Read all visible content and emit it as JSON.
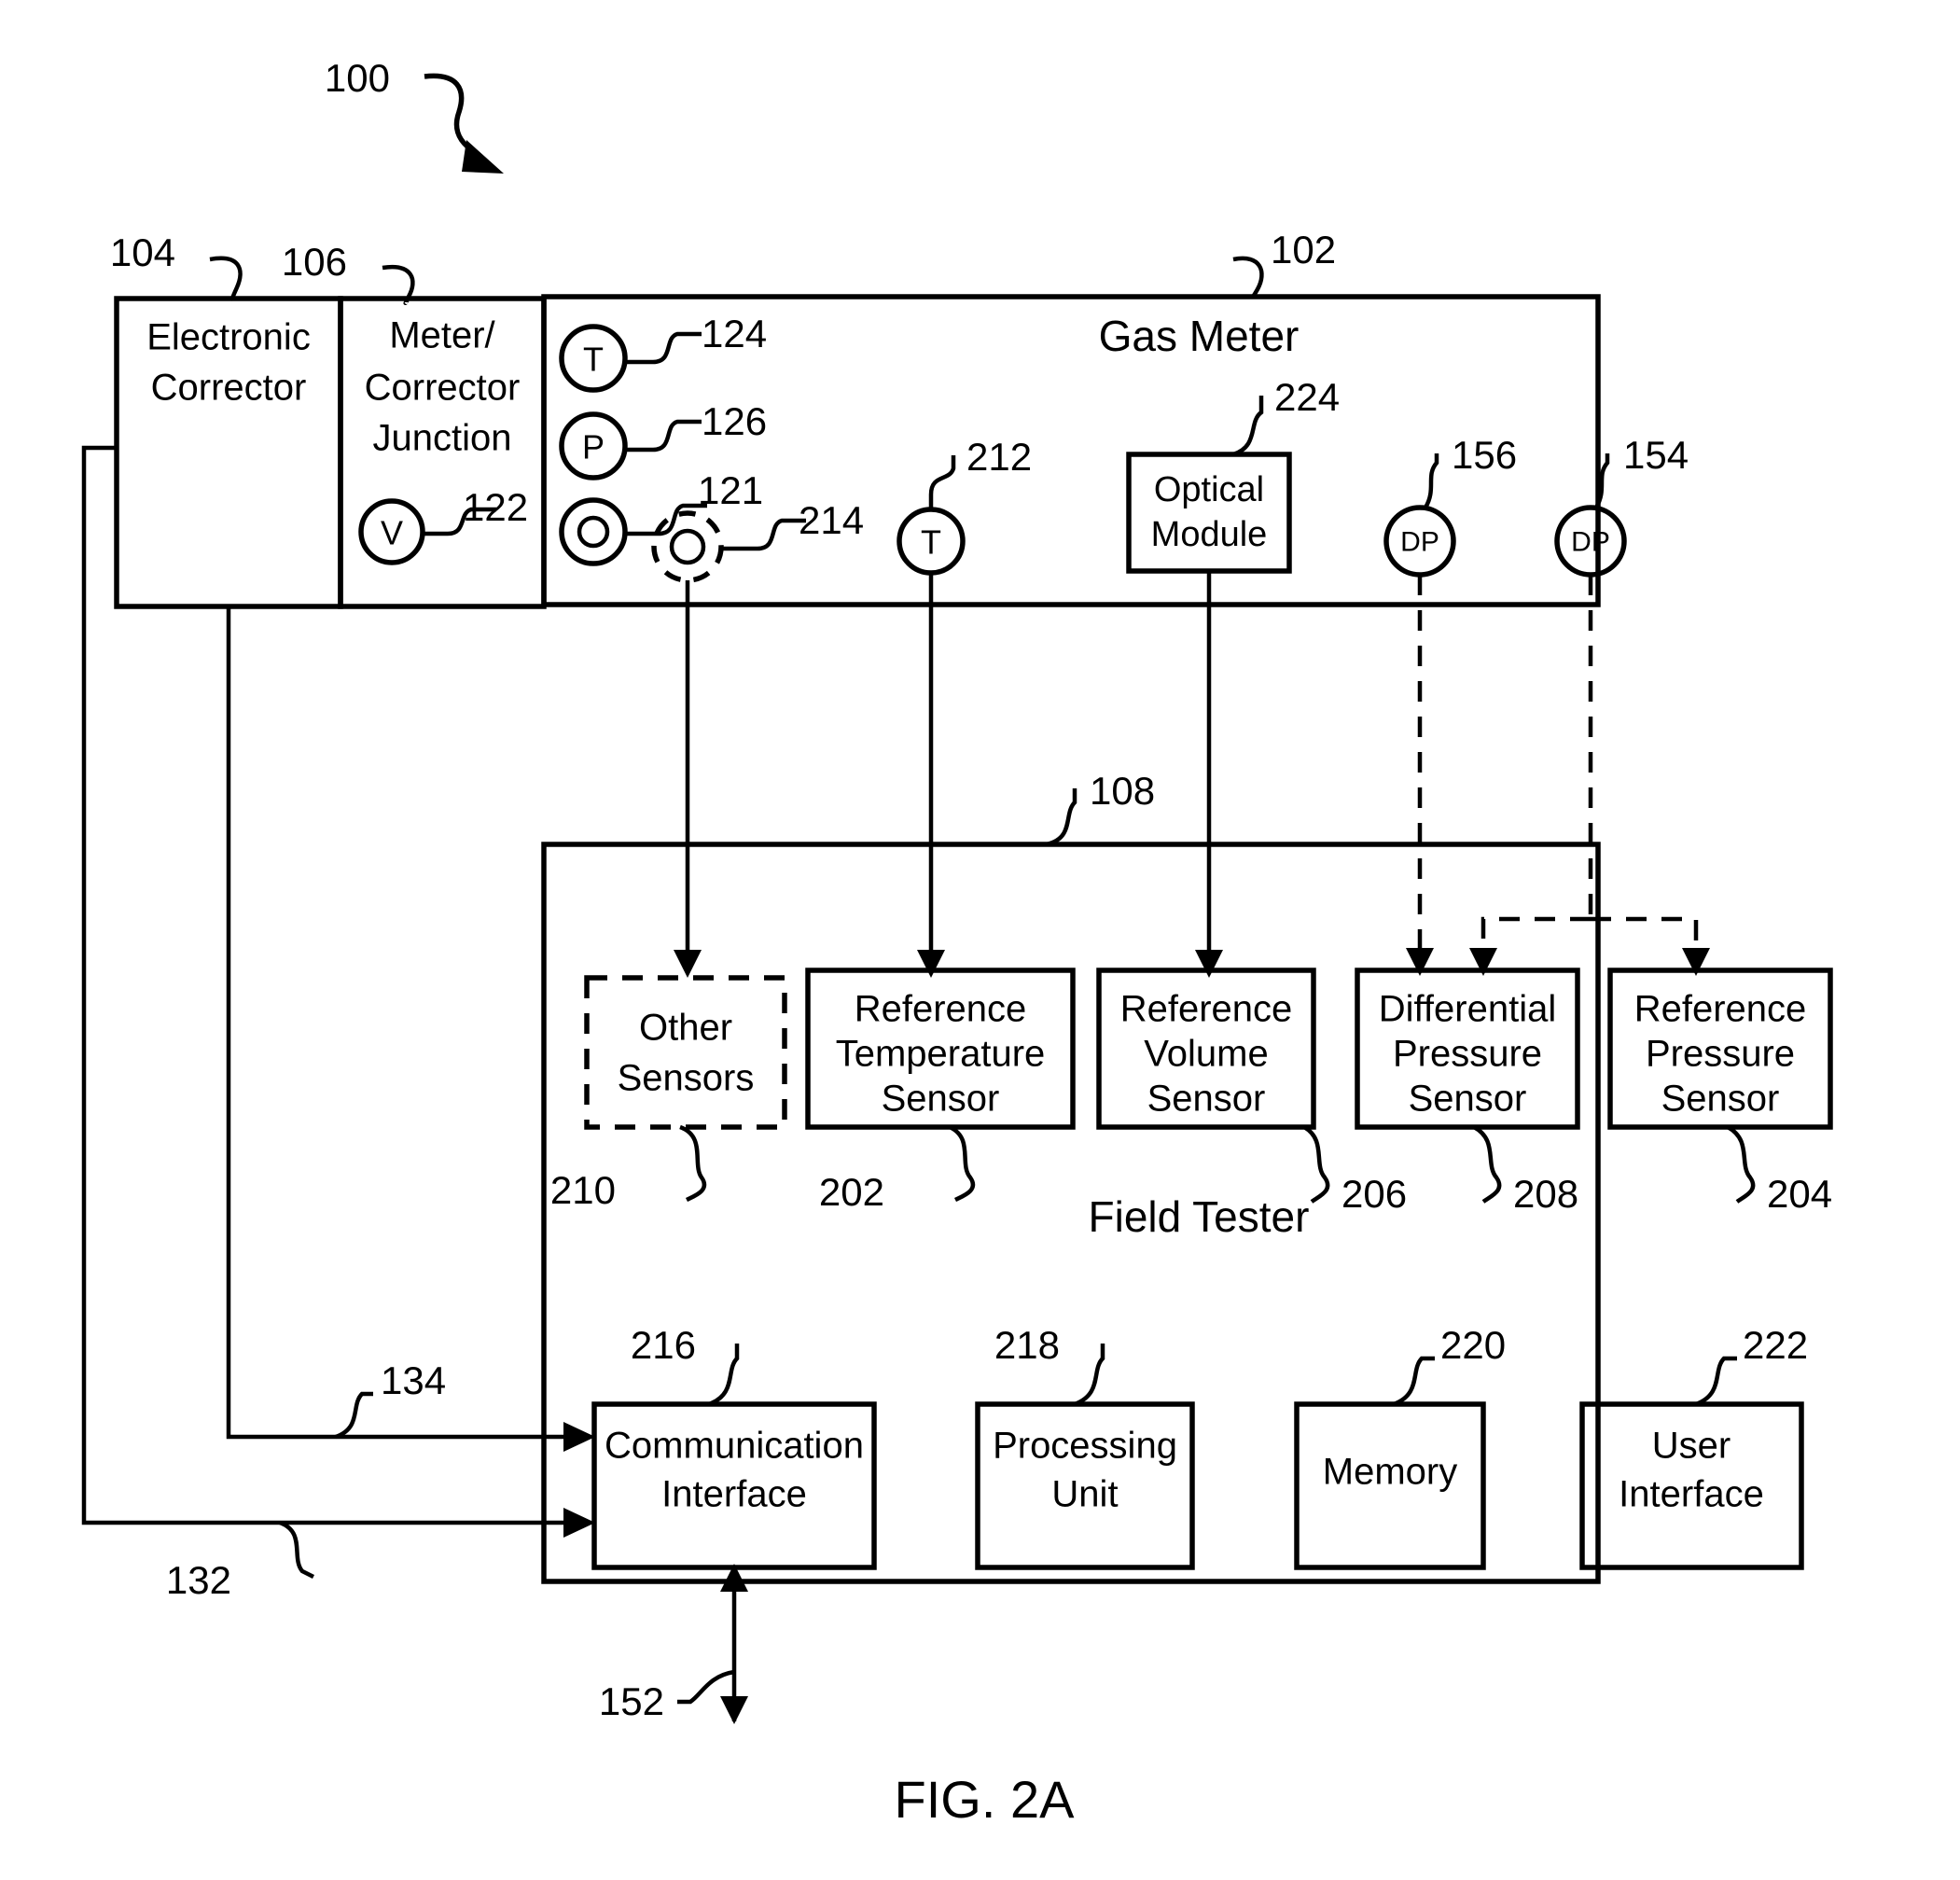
{
  "figure": {
    "caption": "FIG. 2A",
    "system_ref": "100"
  },
  "blocks": {
    "electronic_corrector": {
      "label_line1": "Electronic",
      "label_line2": "Corrector",
      "ref": "104"
    },
    "meter_corrector_junction": {
      "label_line1": "Meter/",
      "label_line2": "Corrector",
      "label_line3": "Junction",
      "ref": "106"
    },
    "gas_meter": {
      "label": "Gas Meter",
      "ref": "102"
    },
    "field_tester": {
      "label": "Field Tester",
      "ref": "108"
    },
    "optical_module": {
      "label_line1": "Optical",
      "label_line2": "Module",
      "ref": "224"
    },
    "other_sensors": {
      "label_line1": "Other",
      "label_line2": "Sensors",
      "ref": "210"
    },
    "reference_temperature_sensor": {
      "label_line1": "Reference",
      "label_line2": "Temperature",
      "label_line3": "Sensor",
      "ref": "202"
    },
    "reference_volume_sensor": {
      "label_line1": "Reference",
      "label_line2": "Volume",
      "label_line3": "Sensor",
      "ref": "206"
    },
    "differential_pressure_sensor": {
      "label_line1": "Differential",
      "label_line2": "Pressure",
      "label_line3": "Sensor",
      "ref": "208"
    },
    "reference_pressure_sensor": {
      "label_line1": "Reference",
      "label_line2": "Pressure",
      "label_line3": "Sensor",
      "ref": "204"
    },
    "communication_interface": {
      "label_line1": "Communication",
      "label_line2": "Interface",
      "ref": "216"
    },
    "processing_unit": {
      "label_line1": "Processing",
      "label_line2": "Unit",
      "ref": "218"
    },
    "memory": {
      "label": "Memory",
      "ref": "220"
    },
    "user_interface": {
      "label_line1": "User",
      "label_line2": "Interface",
      "ref": "222"
    }
  },
  "sensor_ports": {
    "corrector_volume": {
      "symbol": "V",
      "ref": "122"
    },
    "meter_temperature": {
      "symbol": "T",
      "ref": "124"
    },
    "meter_pressure": {
      "symbol": "P",
      "ref": "126"
    },
    "meter_optical_solid": {
      "symbol": "O",
      "ref": "121"
    },
    "meter_optical_dashed": {
      "symbol": "O",
      "ref": "214"
    },
    "meter_temp_probe": {
      "symbol": "T",
      "ref": "212"
    },
    "differential_pressure_port_left": {
      "symbol": "DP",
      "ref": "156"
    },
    "differential_pressure_port_right": {
      "symbol": "DP",
      "ref": "154"
    }
  },
  "connections": {
    "corrector_link_upper": {
      "ref": "134"
    },
    "corrector_link_lower": {
      "ref": "132"
    },
    "external_comm_link": {
      "ref": "152"
    }
  },
  "colors": {
    "ink": "#000000",
    "paper": "#ffffff"
  }
}
